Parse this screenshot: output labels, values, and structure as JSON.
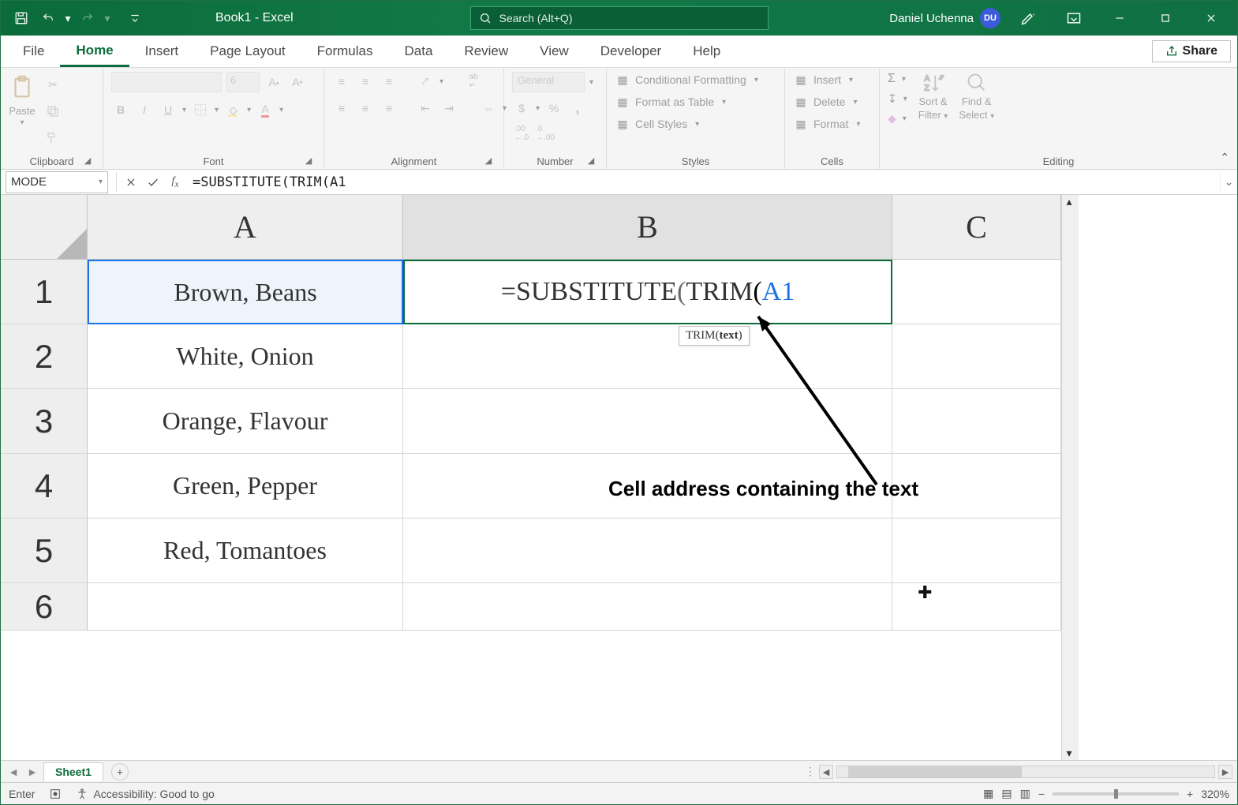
{
  "titlebar": {
    "title_doc": "Book1",
    "title_suffix": "  -  Excel",
    "search_placeholder": "Search (Alt+Q)",
    "user_name": "Daniel Uchenna",
    "user_initials": "DU"
  },
  "tabs": {
    "items": [
      "File",
      "Home",
      "Insert",
      "Page Layout",
      "Formulas",
      "Data",
      "Review",
      "View",
      "Developer",
      "Help"
    ],
    "active_index": 1,
    "share_label": "Share"
  },
  "ribbon": {
    "clipboard": {
      "paste": "Paste",
      "group": "Clipboard"
    },
    "font": {
      "name_placeholder": "",
      "size_placeholder": "6",
      "group": "Font"
    },
    "alignment": {
      "group": "Alignment"
    },
    "number": {
      "general_label": "General",
      "group": "Number"
    },
    "styles": {
      "cond_format": "Conditional Formatting",
      "as_table": "Format as Table",
      "cell_styles": "Cell Styles",
      "group": "Styles"
    },
    "cells": {
      "insert": "Insert",
      "delete": "Delete",
      "format": "Format",
      "group": "Cells"
    },
    "editing": {
      "sort_filter1": "Sort &",
      "sort_filter2": "Filter",
      "find_select1": "Find &",
      "find_select2": "Select",
      "group": "Editing"
    }
  },
  "formula_bar": {
    "name_box": "MODE",
    "formula_text": "=SUBSTITUTE(TRIM(A1"
  },
  "columns": [
    "A",
    "B",
    "C"
  ],
  "rows": [
    "1",
    "2",
    "3",
    "4",
    "5",
    "6"
  ],
  "cells": {
    "A1": "Brown, Beans",
    "A2": "White, Onion",
    "A3": "Orange, Flavour",
    "A4": "Green, Pepper",
    "A5": "Red, Tomantoes",
    "B1_formula_prefix": "=SUBSTITUTE",
    "B1_paren1": "(",
    "B1_trim": "TRIM",
    "B1_paren2": "(",
    "B1_ref": "A1"
  },
  "tooltip": {
    "trim_prefix": "TRIM(",
    "trim_bold": "text",
    "trim_suffix": ")"
  },
  "annotation": {
    "text": "Cell address containing the text"
  },
  "sheet_strip": {
    "sheet_name": "Sheet1"
  },
  "statusbar": {
    "mode": "Enter",
    "accessibility": "Accessibility: Good to go",
    "zoom": "320%"
  }
}
